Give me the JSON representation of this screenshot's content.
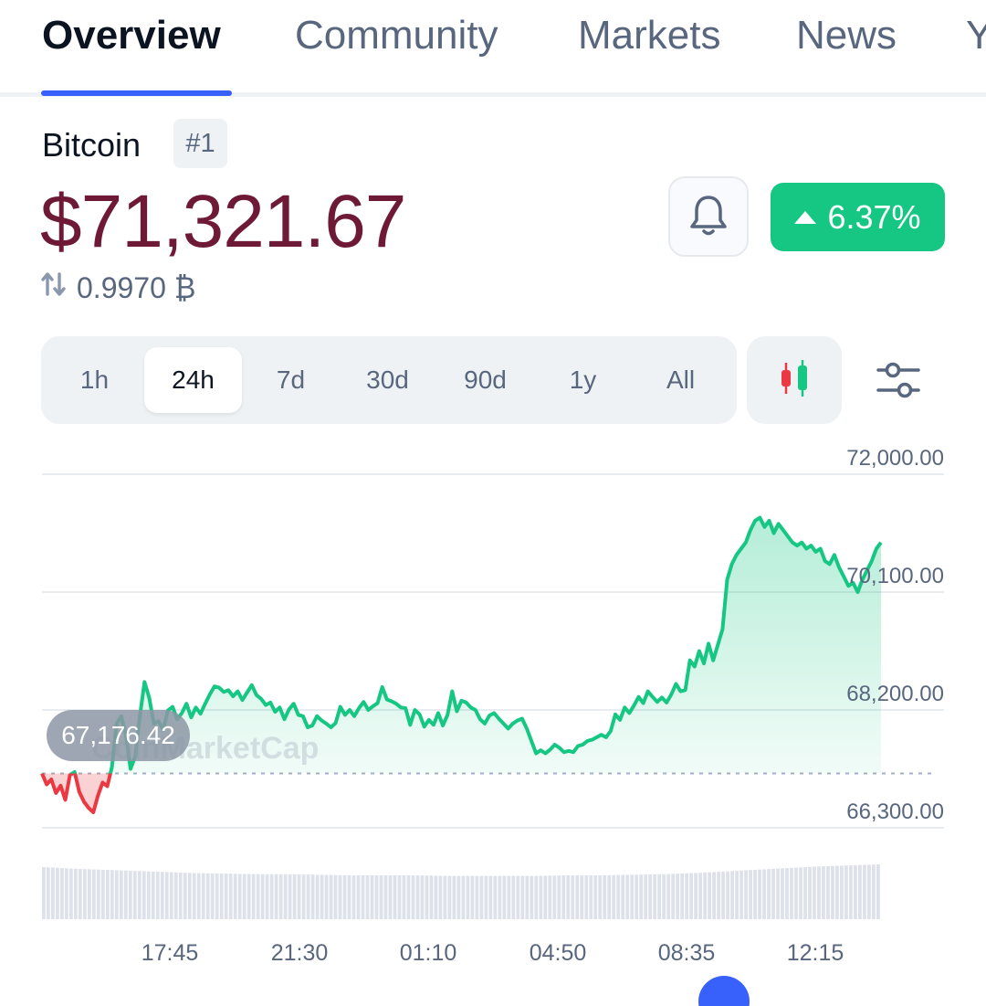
{
  "tabs": [
    {
      "label": "Overview",
      "active": true
    },
    {
      "label": "Community",
      "active": false
    },
    {
      "label": "Markets",
      "active": false
    },
    {
      "label": "News",
      "active": false
    },
    {
      "label": "Y",
      "active": false
    }
  ],
  "coin": {
    "name": "Bitcoin",
    "rank": "#1",
    "price": "$71,321.67",
    "btc_value": "0.9970 ₿",
    "change": "6.37%"
  },
  "ranges": [
    {
      "label": "1h",
      "active": false
    },
    {
      "label": "24h",
      "active": true
    },
    {
      "label": "7d",
      "active": false
    },
    {
      "label": "30d",
      "active": false
    },
    {
      "label": "90d",
      "active": false
    },
    {
      "label": "1y",
      "active": false
    },
    {
      "label": "All",
      "active": false
    }
  ],
  "icons": {
    "bell": "bell-icon",
    "candle": "candlestick-icon",
    "settings": "sliders-icon",
    "swap": "swap-arrows-icon"
  },
  "colors": {
    "up": "#16c784",
    "down": "#ea3943",
    "price": "#6e1a37",
    "accent": "#3861fb"
  },
  "tooltip": {
    "value": "67,176.42"
  },
  "watermark": "CoinMarketCap",
  "chart_data": {
    "type": "line",
    "title": "",
    "xlabel": "",
    "ylabel": "",
    "y_ticks": [
      "72,000.00",
      "70,100.00",
      "68,200.00",
      "66,300.00"
    ],
    "x_ticks": [
      "17:45",
      "21:30",
      "01:10",
      "04:50",
      "08:35",
      "12:15"
    ],
    "ylim": [
      66300,
      72000
    ],
    "baseline": 67176.42,
    "grid": true,
    "series": [
      {
        "values": [
          67176,
          67000,
          67080,
          66860,
          66980,
          66750,
          67150,
          67200,
          66880,
          66720,
          66620,
          66550,
          66820,
          67030,
          66970,
          67280,
          67980,
          68100,
          67800,
          67250,
          67450,
          68100,
          68650,
          68400,
          67980,
          68020,
          67880,
          68190,
          68250,
          68050,
          68150,
          68300,
          68080,
          68240,
          68140,
          68300,
          68450,
          68580,
          68560,
          68490,
          68520,
          68420,
          68500,
          68360,
          68480,
          68600,
          68440,
          68380,
          68280,
          68320,
          68170,
          68240,
          68050,
          68210,
          68300,
          68120,
          68100,
          67920,
          67950,
          68100,
          68030,
          67980,
          67920,
          67990,
          68250,
          68120,
          68200,
          68100,
          68230,
          68330,
          68200,
          68260,
          68310,
          68570,
          68370,
          68340,
          68300,
          68240,
          68230,
          67960,
          68200,
          68130,
          67930,
          68040,
          67960,
          68150,
          67950,
          68120,
          68500,
          68180,
          68350,
          68320,
          68240,
          68200,
          68050,
          67980,
          68110,
          68150,
          68060,
          67980,
          67900,
          67980,
          68030,
          68060,
          67900,
          67700,
          67500,
          67550,
          67500,
          67560,
          67640,
          67590,
          67520,
          67540,
          67520,
          67620,
          67640,
          67700,
          67720,
          67760,
          67800,
          67760,
          67860,
          68130,
          68040,
          68240,
          68150,
          68270,
          68410,
          68310,
          68500,
          68410,
          68330,
          68400,
          68320,
          68450,
          68620,
          68500,
          68520,
          69000,
          68900,
          69150,
          68950,
          69270,
          69000,
          69250,
          69500,
          70300,
          70550,
          70700,
          70800,
          70900,
          71100,
          71250,
          71300,
          71150,
          71250,
          71050,
          71200,
          71100,
          71000,
          70900,
          70850,
          70900,
          70800,
          70850,
          70750,
          70800,
          70600,
          70550,
          70700,
          70500,
          70350,
          70200,
          70250,
          70100,
          70300,
          70450,
          70600,
          70800,
          70900
        ]
      }
    ],
    "volume": [
      0.95,
      0.92,
      0.9,
      0.88,
      0.86,
      0.84,
      0.83,
      0.82,
      0.82,
      0.81,
      0.8,
      0.8,
      0.8,
      0.79,
      0.79,
      0.79,
      0.79,
      0.8,
      0.8,
      0.81,
      0.82,
      0.84,
      0.87,
      0.9,
      0.93,
      0.96,
      0.98,
      1.0
    ]
  }
}
